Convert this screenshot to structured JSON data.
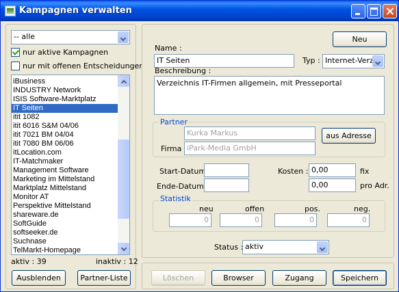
{
  "window": {
    "title": "Kampagnen verwalten"
  },
  "left": {
    "filter_value": "-- alle",
    "check_active_label": "nur aktive Kampagnen",
    "check_active_checked": true,
    "check_open_label": "nur mit offenen Entscheidungen",
    "check_open_checked": false,
    "items": [
      "iBusiness",
      "INDUSTRY Network",
      "ISIS Software-Marktplatz",
      "IT Seiten",
      "itit 1082",
      "itit 6016 S&M 04/06",
      "itit 7021 BM 04/04",
      "itit 7080 BM 06/06",
      "itLocation.com",
      "IT-Matchmaker",
      "Management Software",
      "Marketing im Mittelstand",
      "Marktplatz Mittelstand",
      "Monitor AT",
      "Perspektive Mittelstand",
      "shareware.de",
      "SoftGuide",
      "softseeker.de",
      "Suchnase",
      "TelMarkt-Homepage"
    ],
    "selected_item": "IT Seiten",
    "active_count": "aktiv : 39",
    "inactive_count": "inaktiv : 12",
    "hide_button": "Ausblenden",
    "partner_list_button": "Partner-Liste"
  },
  "form": {
    "new_button": "Neu",
    "name_label": "Name :",
    "name_value": "IT Seiten",
    "type_label": "Typ :",
    "type_value": "Internet-Verze",
    "description_label": "Beschreibung :",
    "description_value": "Verzeichnis IT-Firmen allgemein, mit Presseportal",
    "partner": {
      "title": "Partner",
      "person_value": "Kurka Markus",
      "company_label": "Firma :",
      "company_value": "iPark-Media GmbH",
      "address_button": "aus Adresse"
    },
    "start_label": "Start-Datum :",
    "start_value": "",
    "end_label": "Ende-Datum :",
    "end_value": "",
    "cost_label": "Kosten :",
    "cost_fixed_value": "0,00",
    "cost_fixed_unit": "fix",
    "cost_per_value": "0,00",
    "cost_per_unit": "pro Adr.",
    "stats": {
      "title": "Statistik",
      "cols": [
        {
          "label": "neu",
          "value": "0"
        },
        {
          "label": "offen",
          "value": "0"
        },
        {
          "label": "pos.",
          "value": "0"
        },
        {
          "label": "neg.",
          "value": "0"
        }
      ]
    },
    "status_label": "Status :",
    "status_value": "aktiv"
  },
  "footer": {
    "delete_button": "Löschen",
    "browser_button": "Browser",
    "access_button": "Zugang",
    "save_button": "Speichern"
  }
}
